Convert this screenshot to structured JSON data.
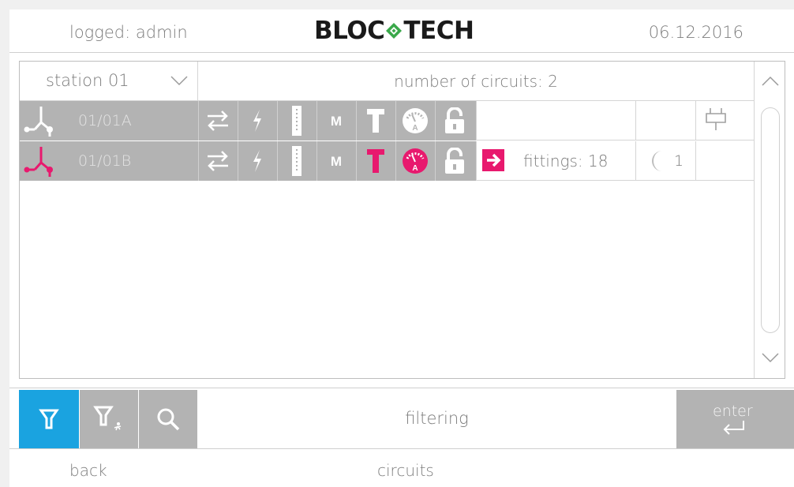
{
  "header": {
    "login": "logged: admin",
    "logo_left": "BLOC",
    "logo_right": "TECH",
    "date": "06.12.2016"
  },
  "table": {
    "station": "station 01",
    "circuits_count": "number of circuits: 2",
    "rows": [
      {
        "name": "01/01A",
        "highlight": false,
        "fittings": "",
        "night": ""
      },
      {
        "name": "01/01B",
        "highlight": true,
        "fittings": "fittings: 18",
        "night": "1"
      }
    ]
  },
  "toolbar": {
    "filter_text": "filtering",
    "enter_label": "enter"
  },
  "footer": {
    "back_label": "back",
    "title": "circuits"
  },
  "colors": {
    "accent_blue": "#1aa3e0",
    "alert_magenta": "#e8196e",
    "cell_grey": "#b3b3b3",
    "logo_green": "#3aa84a"
  },
  "icons": [
    "chevron-down-icon",
    "chevron-up-icon",
    "transfer-arrows-icon",
    "lightning-icon",
    "battery-bar-icon",
    "m-mode-icon",
    "t-test-icon",
    "ammeter-gauge-icon",
    "padlock-icon",
    "arrow-right-icon",
    "moon-icon",
    "plug-icon",
    "filter-icon",
    "filter-run-icon",
    "search-icon",
    "enter-arrow-icon"
  ]
}
